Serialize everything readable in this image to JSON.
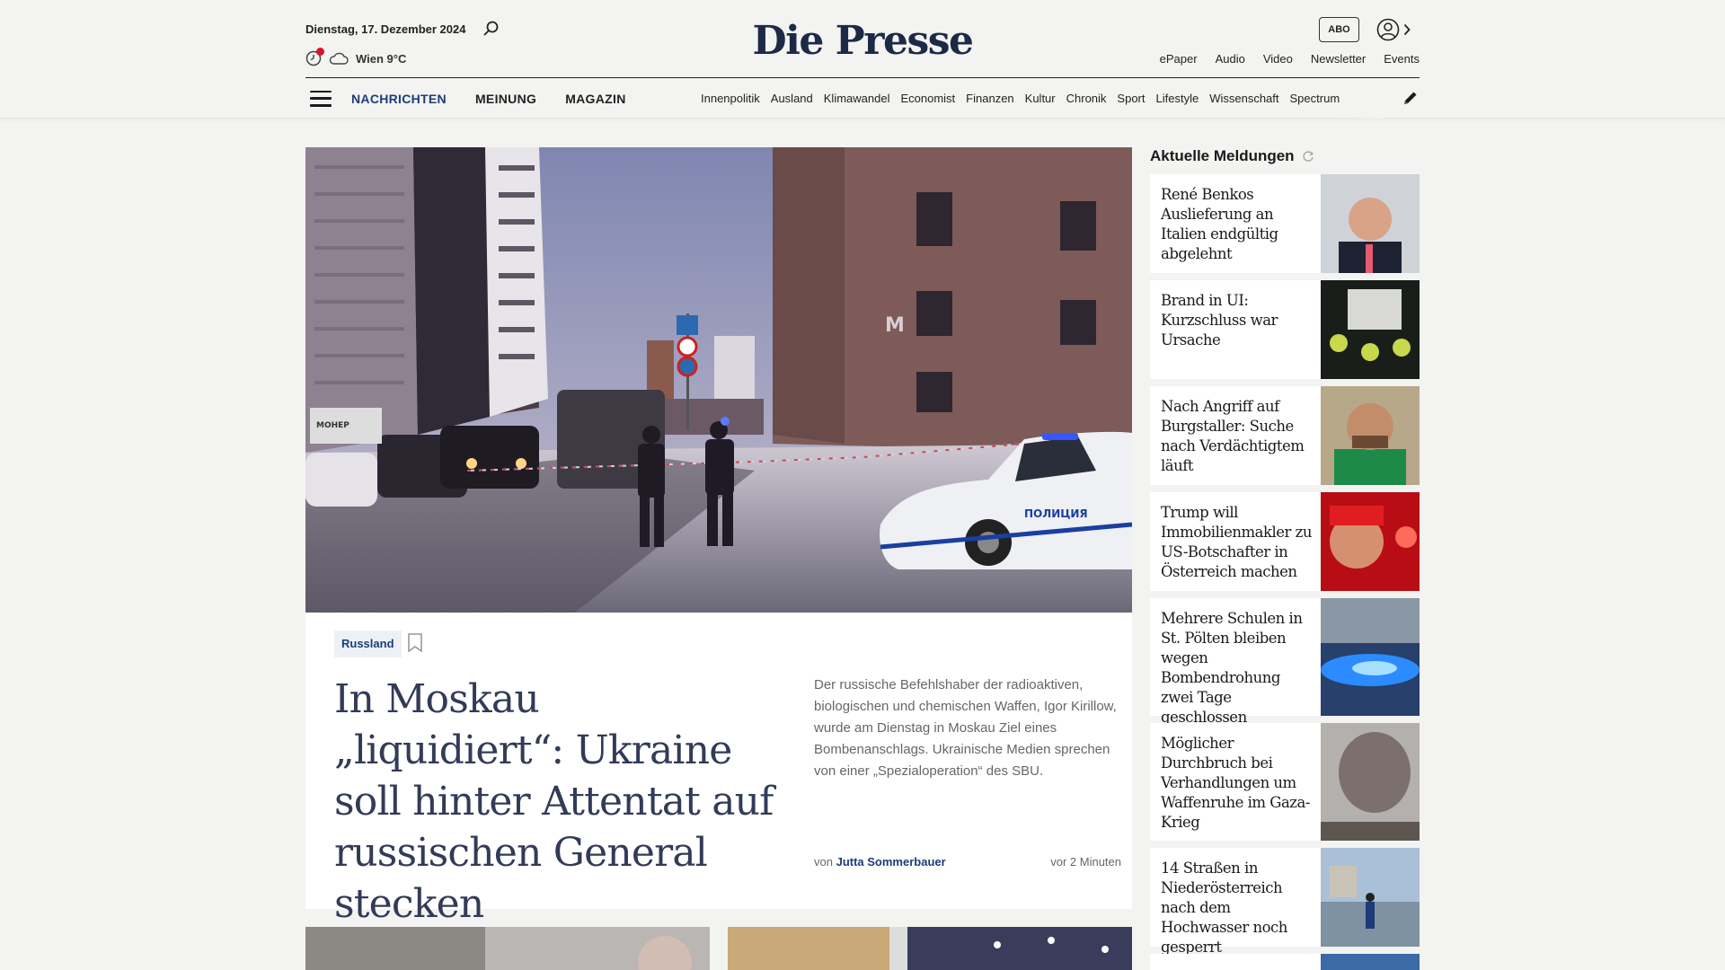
{
  "header": {
    "date": "Dienstag, 17. Dezember 2024",
    "weather": "Wien 9°C",
    "logo": "Die Presse",
    "abo": "ABO",
    "services": [
      "ePaper",
      "Audio",
      "Video",
      "Newsletter",
      "Events"
    ]
  },
  "nav": {
    "main": [
      "NACHRICHTEN",
      "MEINUNG",
      "MAGAZIN"
    ],
    "sub": [
      "Innenpolitik",
      "Ausland",
      "Klimawandel",
      "Economist",
      "Finanzen",
      "Kultur",
      "Chronik",
      "Sport",
      "Lifestyle",
      "Wissenschaft",
      "Spectrum"
    ]
  },
  "lead": {
    "tag": "Russland",
    "headline": "In Moskau „liquidiert“: Ukraine soll hinter Attentat auf russischen General stecken",
    "teaser": "Der russische Befehlshaber der radioaktiven, biologischen und chemischen Waffen, Igor Kirillow, wurde am Dienstag in Moskau Ziel eines Bombenanschlags. Ukrainische Medien sprechen von einer „Spezialoperation“ des SBU.",
    "byline_prefix": "von",
    "author": "Jutta Sommerbauer",
    "time": "vor 2 Minuten"
  },
  "sidebar": {
    "title": "Aktuelle Meldungen",
    "items": [
      {
        "text": "René Benkos Auslieferung an Italien endgültig abgelehnt"
      },
      {
        "text": "Brand in UI: Kurzschluss war Ursache"
      },
      {
        "text": "Nach Angriff auf Burgstaller: Suche nach Verdächtigtem läuft"
      },
      {
        "text": "Trump will Immobilienmakler zu US-Botschafter in Österreich machen"
      },
      {
        "text": "Mehrere Schulen in St. Pölten bleiben wegen Bombendrohung zwei Tage geschlossen"
      },
      {
        "text": "Möglicher Durchbruch bei Verhandlungen um Waffenruhe im Gaza-Krieg"
      },
      {
        "text": "14 Straßen in Niederösterreich nach dem Hochwasser noch gesperrt"
      }
    ]
  },
  "colors": {
    "brand": "#1c2a47",
    "accent": "#1c3c78",
    "alert": "#d7142b"
  }
}
